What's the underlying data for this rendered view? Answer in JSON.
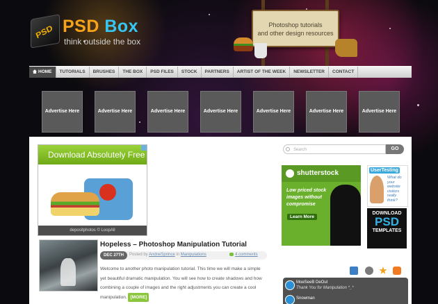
{
  "logo": {
    "icon_text": "PSD",
    "title_part1": "PSD",
    "title_part2": "Box",
    "tagline": "think outside the box"
  },
  "sign": {
    "line1": "Photoshop tutorials",
    "line2": "and other design resources"
  },
  "nav": {
    "items": [
      {
        "label": "HOME",
        "icon": "home-icon",
        "active": true
      },
      {
        "label": "TUTORIALS"
      },
      {
        "label": "BRUSHES"
      },
      {
        "label": "THE BOX"
      },
      {
        "label": "PSD FILES"
      },
      {
        "label": "STOCK"
      },
      {
        "label": "PARTNERS"
      },
      {
        "label": "ARTIST OF THE WEEK"
      },
      {
        "label": "NEWSLETTER"
      },
      {
        "label": "CONTACT"
      }
    ]
  },
  "ads": {
    "slots": [
      "Advertise Here",
      "Advertise Here",
      "Advertise Here",
      "Advertise Here",
      "Advertise Here",
      "Advertise Here",
      "Advertise Here"
    ]
  },
  "banner": {
    "headline": "Download Absolutely Free",
    "footer": "depositphotos © LoopAll"
  },
  "post": {
    "title": "Hopeless – Photoshop Manipulation Tutorial",
    "date": "DEC 27TH",
    "posted_by_prefix": "Posted by",
    "author": "AndreiSprince",
    "in_word": "in",
    "category": "Manipulations",
    "comments": "4 comments",
    "excerpt": "Welcome to another photo manipulation tutorial. This time we will make a simple yet beautiful dramatic manipulation. You will see how to create shadows and how combining a couple of images and the right adjustments you can create a cool manipulation.",
    "more_label": "[MORE]"
  },
  "search": {
    "placeholder": "Search",
    "button": "GO"
  },
  "sidebar_ads": {
    "shutterstock": {
      "brand": "shutterstock",
      "copy": "Low priced stock images without compromise",
      "button": "Learn More"
    },
    "usertesting": {
      "brand": "UserTesting",
      "copy": "What do your website visitors really think?"
    },
    "download": {
      "line1": "DOWNLOAD",
      "line2": "PSD",
      "line3": "TEMPLATES"
    }
  },
  "tabs": {
    "icons": [
      "tag-icon",
      "clock-icon",
      "star-icon",
      "comment-icon"
    ]
  },
  "twitter": {
    "tweets": [
      {
        "name": "MoeSeeB DeOul",
        "msg": "Thank You for Manipulation *_*"
      },
      {
        "name": "Snowman",
        "msg": ""
      }
    ]
  },
  "colors": {
    "accent_orange": "#f7a21b",
    "accent_blue": "#37c6f2",
    "green": "#8cc63f"
  }
}
